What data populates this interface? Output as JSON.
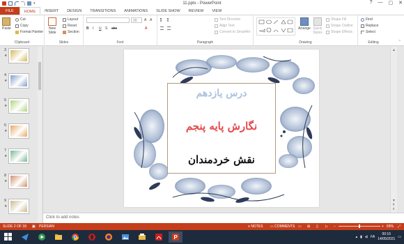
{
  "window": {
    "title": "11.pptx - PowerPoint",
    "controls": [
      "?",
      "—",
      "▢",
      "✕"
    ]
  },
  "tabs": [
    {
      "label": "FILE"
    },
    {
      "label": "HOME"
    },
    {
      "label": "INSERT"
    },
    {
      "label": "DESIGN"
    },
    {
      "label": "TRANSITIONS"
    },
    {
      "label": "ANIMATIONS"
    },
    {
      "label": "SLIDE SHOW"
    },
    {
      "label": "REVIEW"
    },
    {
      "label": "VIEW"
    }
  ],
  "ribbon": {
    "clipboard": {
      "label": "Clipboard",
      "paste": "Paste",
      "cut": "Cut",
      "copy": "Copy",
      "format_painter": "Format Painter"
    },
    "slides": {
      "label": "Slides",
      "new_slide": "New Slide",
      "layout": "Layout",
      "reset": "Reset",
      "section": "Section"
    },
    "font": {
      "label": "Font",
      "size": "20"
    },
    "paragraph": {
      "label": "Paragraph",
      "text_direction": "Text Direction",
      "align_text": "Align Text",
      "convert_smartart": "Convert to SmartArt"
    },
    "drawing": {
      "label": "Drawing",
      "arrange": "Arrange",
      "quick_styles": "Quick Styles",
      "shape_fill": "Shape Fill",
      "shape_outline": "Shape Outline",
      "shape_effects": "Shape Effects"
    },
    "editing": {
      "label": "Editing",
      "find": "Find",
      "replace": "Replace",
      "select": "Select"
    }
  },
  "thumbnails": [
    {
      "num": "3",
      "accent": "#c9a227"
    },
    {
      "num": "4",
      "accent": "#5a7fb8"
    },
    {
      "num": "5",
      "accent": "#9ac455"
    },
    {
      "num": "6",
      "accent": "#e08b2c"
    },
    {
      "num": "7",
      "accent": "#4f9e6f"
    },
    {
      "num": "8",
      "accent": "#c46a3b"
    },
    {
      "num": "9",
      "accent": "#b9a06a"
    }
  ],
  "slide": {
    "line1": "درس یازدهم",
    "line2": "نگارش پایه پنجم",
    "line3": "نقش خردمندان"
  },
  "notes": {
    "placeholder": "Click to add notes"
  },
  "status": {
    "slide_of": "SLIDE 2 OF 18",
    "language": "PERSIAN",
    "notes": "NOTES",
    "comments": "COMMENTS",
    "zoom": "69%"
  },
  "taskbar": {
    "lang": "FA",
    "time": "00:16",
    "date": "14/05/2021"
  },
  "colors": {
    "accent": "#c43e1c",
    "taskbar": "#1e2b3c"
  }
}
